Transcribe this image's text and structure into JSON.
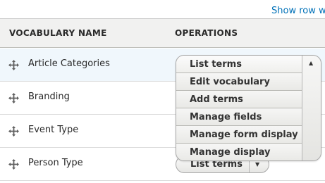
{
  "header": {
    "show_row_weights": "Show row we"
  },
  "table": {
    "columns": {
      "name": "VOCABULARY NAME",
      "operations": "OPERATIONS"
    },
    "rows": [
      {
        "name": "Article Categories"
      },
      {
        "name": "Branding"
      },
      {
        "name": "Event Type"
      },
      {
        "name": "Person Type",
        "primary_op": "List terms"
      }
    ]
  },
  "dropdown": {
    "items": [
      "List terms",
      "Edit vocabulary",
      "Add terms",
      "Manage fields",
      "Manage form display",
      "Manage display"
    ],
    "toggle_icon": "caret-up-icon"
  },
  "icons": {
    "drag": "drag-handle-icon"
  },
  "colors": {
    "link": "#0071b8",
    "header_bg": "#f1f1f0",
    "selected_row_bg": "#f0f7fc"
  }
}
